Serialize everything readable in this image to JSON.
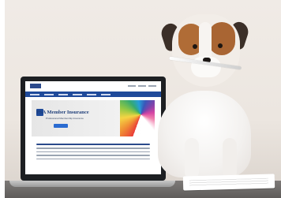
{
  "scene": {
    "type": "photo"
  },
  "laptop": {
    "hero_title": "PSA Member Insurance",
    "hero_subtitle": "Professional Membership Insurance"
  }
}
